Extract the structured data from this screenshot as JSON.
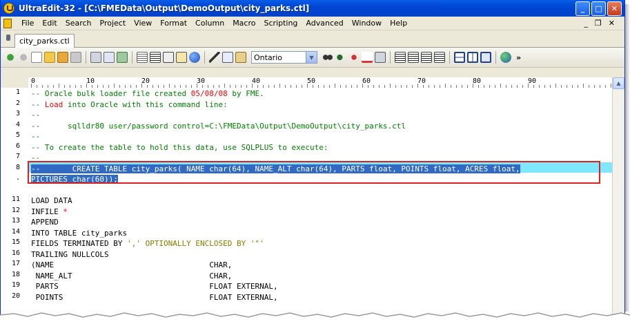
{
  "window": {
    "title": "UltraEdit-32 - [C:\\FMEData\\Output\\DemoOutput\\city_parks.ctl]",
    "controls": {
      "minimize": "_",
      "maximize": "□",
      "close": "✕"
    }
  },
  "menu": {
    "items": [
      "File",
      "Edit",
      "Search",
      "Project",
      "View",
      "Format",
      "Column",
      "Macro",
      "Scripting",
      "Advanced",
      "Window",
      "Help"
    ],
    "mdi": {
      "minimize": "_",
      "restore": "❐",
      "close": "✕"
    }
  },
  "tabs": [
    {
      "label": "city_parks.ctl"
    }
  ],
  "toolbar": {
    "font_combo": "Ontario",
    "more": "»",
    "icons": [
      "back-icon",
      "forward-icon",
      "new-file-icon",
      "open-folder-icon",
      "save-icon",
      "save-all-icon",
      "print-icon",
      "print-preview-icon",
      "image-icon",
      "page-icon",
      "word-wrap-icon",
      "hex-icon",
      "document-icon",
      "globe-icon",
      "cut-icon",
      "copy-icon",
      "paste-icon",
      "find-icon",
      "find-next-icon",
      "replace-icon",
      "spell-check-icon",
      "print-setup-icon",
      "align-left-icon",
      "align-center-icon",
      "align-right-icon",
      "justify-icon",
      "split-horizontal-icon",
      "split-vertical-icon",
      "cascade-icon",
      "web-icon"
    ]
  },
  "ruler": {
    "labels": [
      "0",
      "10",
      "20",
      "30",
      "40",
      "50",
      "60",
      "70",
      "80",
      "90"
    ]
  },
  "editor": {
    "lines": [
      {
        "n": "1",
        "parts": [
          {
            "t": "-- Oracle bulk loader file created ",
            "c": "comment"
          },
          {
            "t": "05/08/08",
            "c": "red"
          },
          {
            "t": " by FME.",
            "c": "comment"
          }
        ]
      },
      {
        "n": "2",
        "parts": [
          {
            "t": "-- ",
            "c": "comment"
          },
          {
            "t": "Load",
            "c": "red"
          },
          {
            "t": " into Oracle with this command line:",
            "c": "comment"
          }
        ]
      },
      {
        "n": "3",
        "parts": [
          {
            "t": "--",
            "c": "comment"
          }
        ]
      },
      {
        "n": "4",
        "parts": [
          {
            "t": "--      sqlldr80 user/password control=C:\\FMEData\\Output\\DemoOutput\\city_parks.ctl",
            "c": "comment"
          }
        ]
      },
      {
        "n": "5",
        "parts": [
          {
            "t": "--",
            "c": "comment"
          }
        ]
      },
      {
        "n": "6",
        "parts": [
          {
            "t": "-- To create the table to hold this data, use SQLPLUS to execute:",
            "c": "comment"
          }
        ]
      },
      {
        "n": "7",
        "parts": [
          {
            "t": "--",
            "c": "comment"
          }
        ]
      },
      {
        "n": "8",
        "parts": [
          {
            "t": "--       ",
            "c": "sel"
          },
          {
            "t": "CREATE TABLE city_parks( NAME char(64), NAME_ALT char(64), PARTS float, POINTS float, ACRES float,",
            "c": "sel"
          }
        ]
      },
      {
        "n": ".",
        "parts": [
          {
            "t": "PICTURES char(60));",
            "c": "sel"
          }
        ]
      },
      {
        "n": "",
        "parts": []
      },
      {
        "n": "11",
        "parts": [
          {
            "t": "LOAD DATA",
            "c": "plain"
          }
        ]
      },
      {
        "n": "12",
        "parts": [
          {
            "t": "INFILE ",
            "c": "plain"
          },
          {
            "t": "*",
            "c": "red"
          }
        ]
      },
      {
        "n": "13",
        "parts": [
          {
            "t": "APPEND",
            "c": "plain"
          }
        ]
      },
      {
        "n": "14",
        "parts": [
          {
            "t": "INTO TABLE city_parks",
            "c": "plain"
          }
        ]
      },
      {
        "n": "15",
        "parts": [
          {
            "t": "FIELDS TERMINATED BY ",
            "c": "plain"
          },
          {
            "t": "',' OPTIONALLY ENCLOSED BY '\"'",
            "c": "str"
          }
        ]
      },
      {
        "n": "16",
        "parts": [
          {
            "t": "TRAILING NULLCOLS",
            "c": "plain"
          }
        ]
      },
      {
        "n": "17",
        "parts": [
          {
            "t": "(NAME                                  CHAR,",
            "c": "plain"
          }
        ]
      },
      {
        "n": "18",
        "parts": [
          {
            "t": " NAME_ALT                              CHAR,",
            "c": "plain"
          }
        ]
      },
      {
        "n": "19",
        "parts": [
          {
            "t": " PARTS                                 FLOAT EXTERNAL,",
            "c": "plain"
          }
        ]
      },
      {
        "n": "20",
        "parts": [
          {
            "t": " POINTS                                FLOAT EXTERNAL,",
            "c": "plain"
          }
        ]
      }
    ]
  },
  "scrollbar": {
    "up": "▲"
  }
}
